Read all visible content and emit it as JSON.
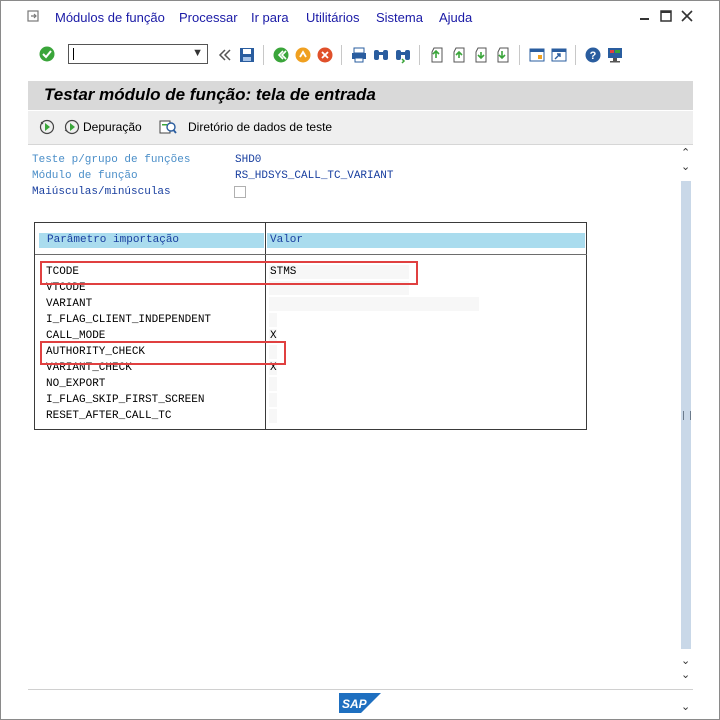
{
  "menubar": {
    "items": [
      {
        "label": "Módulos de função"
      },
      {
        "label": "Processar"
      },
      {
        "label": "Ir para"
      },
      {
        "label": "Utilitários"
      },
      {
        "label": "Sistema"
      },
      {
        "label": "Ajuda"
      }
    ]
  },
  "toolbar": {
    "command_field_value": "",
    "icons": [
      "check-icon",
      "double-left-arrow-icon",
      "save-icon",
      "back-icon",
      "exit-icon",
      "cancel-icon",
      "print-icon",
      "find-icon",
      "find-next-icon",
      "first-page-icon",
      "previous-page-icon",
      "next-page-icon",
      "last-page-icon",
      "create-session-icon",
      "shortcut-icon",
      "help-icon",
      "customize-layout-icon"
    ]
  },
  "title": "Testar módulo de função: tela de entrada",
  "app_toolbar": {
    "execute_label": "",
    "debug_label": "Depuração",
    "test_data_label": "Diretório de dados de teste"
  },
  "fields": {
    "group_label": "Teste p/grupo de funções",
    "group_value": "SHD0",
    "module_label": "Módulo de função",
    "module_value": "RS_HDSYS_CALL_TC_VARIANT",
    "case_label": "Maiúsculas/minúsculas"
  },
  "table": {
    "header_param": "Parâmetro importação",
    "header_value": "Valor",
    "rows": [
      {
        "param": "TCODE",
        "value": "STMS"
      },
      {
        "param": "VTCODE",
        "value": ""
      },
      {
        "param": "VARIANT",
        "value": ""
      },
      {
        "param": "I_FLAG_CLIENT_INDEPENDENT",
        "value": ""
      },
      {
        "param": "CALL_MODE",
        "value": "X"
      },
      {
        "param": "AUTHORITY_CHECK",
        "value": ""
      },
      {
        "param": "VARIANT_CHECK",
        "value": "X"
      },
      {
        "param": "NO_EXPORT",
        "value": ""
      },
      {
        "param": "I_FLAG_SKIP_FIRST_SCREEN",
        "value": ""
      },
      {
        "param": "RESET_AFTER_CALL_TC",
        "value": ""
      }
    ]
  },
  "status": {
    "logo_text": "SAP"
  },
  "colors": {
    "accent_blue": "#1a1aa6",
    "label_blue": "#4a8ec8",
    "header_cyan": "#aadcee",
    "highlight_red": "#e04040"
  }
}
